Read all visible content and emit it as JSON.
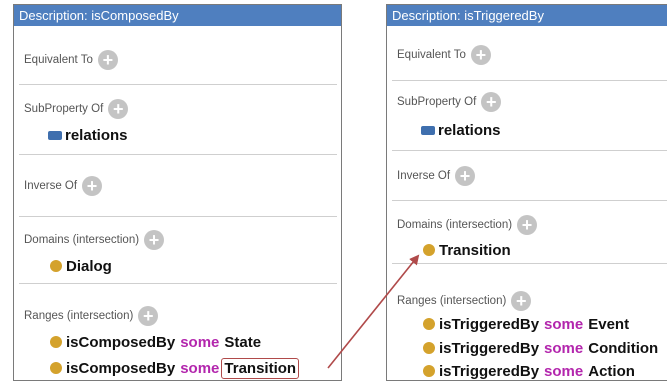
{
  "left_panel": {
    "header": "Description: isComposedBy",
    "equivalent_to": "Equivalent To",
    "subproperty_of": "SubProperty Of",
    "subproperty_item": "relations",
    "inverse_of": "Inverse Of",
    "domains": "Domains (intersection)",
    "domain_item": "Dialog",
    "ranges": "Ranges (intersection)",
    "range_1": {
      "prop": "isComposedBy",
      "kw": "some",
      "target": "State"
    },
    "range_2": {
      "prop": "isComposedBy",
      "kw": "some",
      "target": "Transition"
    }
  },
  "right_panel": {
    "header": "Description: isTriggeredBy",
    "equivalent_to": "Equivalent To",
    "subproperty_of": "SubProperty Of",
    "subproperty_item": "relations",
    "inverse_of": "Inverse Of",
    "domains": "Domains (intersection)",
    "domain_item": "Transition",
    "ranges": "Ranges (intersection)",
    "range_1": {
      "prop": "isTriggeredBy",
      "kw": "some",
      "target": "Event"
    },
    "range_2": {
      "prop": "isTriggeredBy",
      "kw": "some",
      "target": "Condition"
    },
    "range_3": {
      "prop": "isTriggeredBy",
      "kw": "some",
      "target": "Action"
    }
  },
  "icons": {
    "add": "+",
    "class_dot_color": "#d4a22c",
    "property_icon_color": "#3f6fae",
    "keyword_color": "#b326ad",
    "header_color": "#4f7fbf",
    "arrow_color": "#b04a4a"
  }
}
